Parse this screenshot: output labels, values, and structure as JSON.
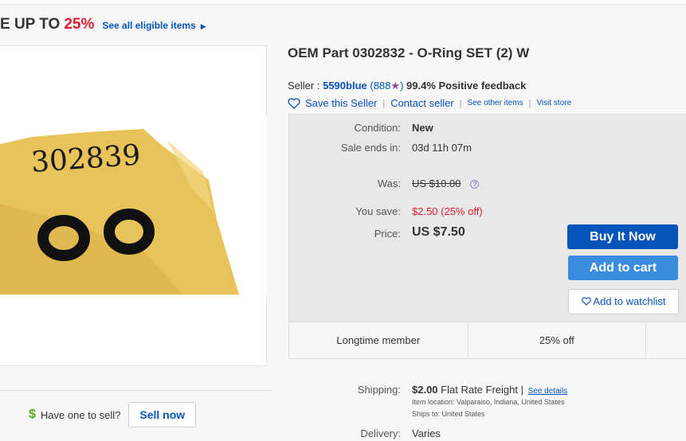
{
  "promo": {
    "text": "E UP TO",
    "percent": "25%",
    "link": "See all eligible items",
    "arrow": "▶"
  },
  "product": {
    "title": "OEM Part 0302832 - O-Ring SET (2) W",
    "image_handwriting": "302839"
  },
  "seller": {
    "prefix": "Seller :",
    "name": "5590blue",
    "count_open": "(888",
    "star": "★",
    "count_close": ")",
    "feedback": "99.4% Positive feedback",
    "save_seller": "Save this Seller",
    "contact": "Contact seller",
    "see_other": "See other items",
    "visit_store": "Visit store"
  },
  "details": {
    "condition_label": "Condition:",
    "condition_value": "New",
    "sale_ends_label": "Sale ends in:",
    "sale_ends_value": "03d 11h 07m",
    "was_label": "Was:",
    "was_value": "US $10.00",
    "info_icon": "?",
    "save_label": "You save:",
    "save_value": "$2.50 (25% off)",
    "price_label": "Price:",
    "price_value": "US $7.50"
  },
  "buttons": {
    "buy_now": "Buy It Now",
    "add_cart": "Add to cart",
    "watchlist": "Add to watchlist"
  },
  "badges": [
    "Longtime member",
    "25% off",
    ""
  ],
  "shipping": {
    "label": "Shipping:",
    "cost": "$2.00",
    "method": "Flat Rate Freight |",
    "see_details": "See details",
    "location": "Item location:  Valparaiso, Indiana, United States",
    "ships_to": "Ships to:  United States",
    "delivery_label": "Delivery:",
    "delivery_value": "Varies"
  },
  "sell": {
    "dollar": "$",
    "question": "Have one to sell?",
    "button": "Sell now"
  },
  "colors": {
    "link": "#0654ba",
    "buy": "#0654ba",
    "cart": "#3a8dde",
    "sale_red": "#dd1e31",
    "panel_bg": "#e8e8e8",
    "star": "#8e44ad"
  }
}
